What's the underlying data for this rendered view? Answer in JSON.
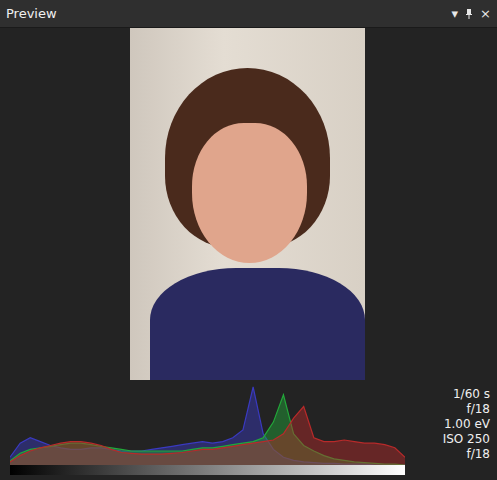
{
  "window": {
    "title": "Preview",
    "menu_glyph": "▾",
    "close_glyph": "×"
  },
  "histogram": {
    "series": [
      {
        "color": "#3a3ac0",
        "values": [
          10,
          28,
          35,
          30,
          25,
          22,
          20,
          20,
          22,
          22,
          20,
          18,
          18,
          18,
          20,
          22,
          24,
          26,
          28,
          30,
          28,
          30,
          35,
          45,
          100,
          40,
          20,
          10,
          6,
          4,
          3,
          2,
          2,
          1,
          1,
          1,
          0,
          0,
          0,
          0
        ]
      },
      {
        "color": "#22a83a",
        "values": [
          5,
          15,
          20,
          22,
          24,
          26,
          28,
          28,
          26,
          24,
          22,
          20,
          18,
          18,
          18,
          18,
          18,
          18,
          20,
          22,
          22,
          24,
          26,
          28,
          30,
          35,
          55,
          90,
          40,
          25,
          18,
          12,
          8,
          6,
          4,
          3,
          2,
          1,
          1,
          0
        ]
      },
      {
        "color": "#b82a2a",
        "values": [
          4,
          12,
          18,
          22,
          25,
          28,
          30,
          30,
          28,
          25,
          20,
          16,
          15,
          14,
          14,
          14,
          15,
          16,
          18,
          20,
          20,
          22,
          24,
          26,
          28,
          30,
          32,
          40,
          60,
          75,
          35,
          30,
          30,
          32,
          30,
          28,
          28,
          26,
          22,
          10
        ]
      }
    ]
  },
  "exposure": [
    "1/60 s",
    "f/18",
    "1.00 eV",
    "ISO 250",
    "f/18"
  ]
}
